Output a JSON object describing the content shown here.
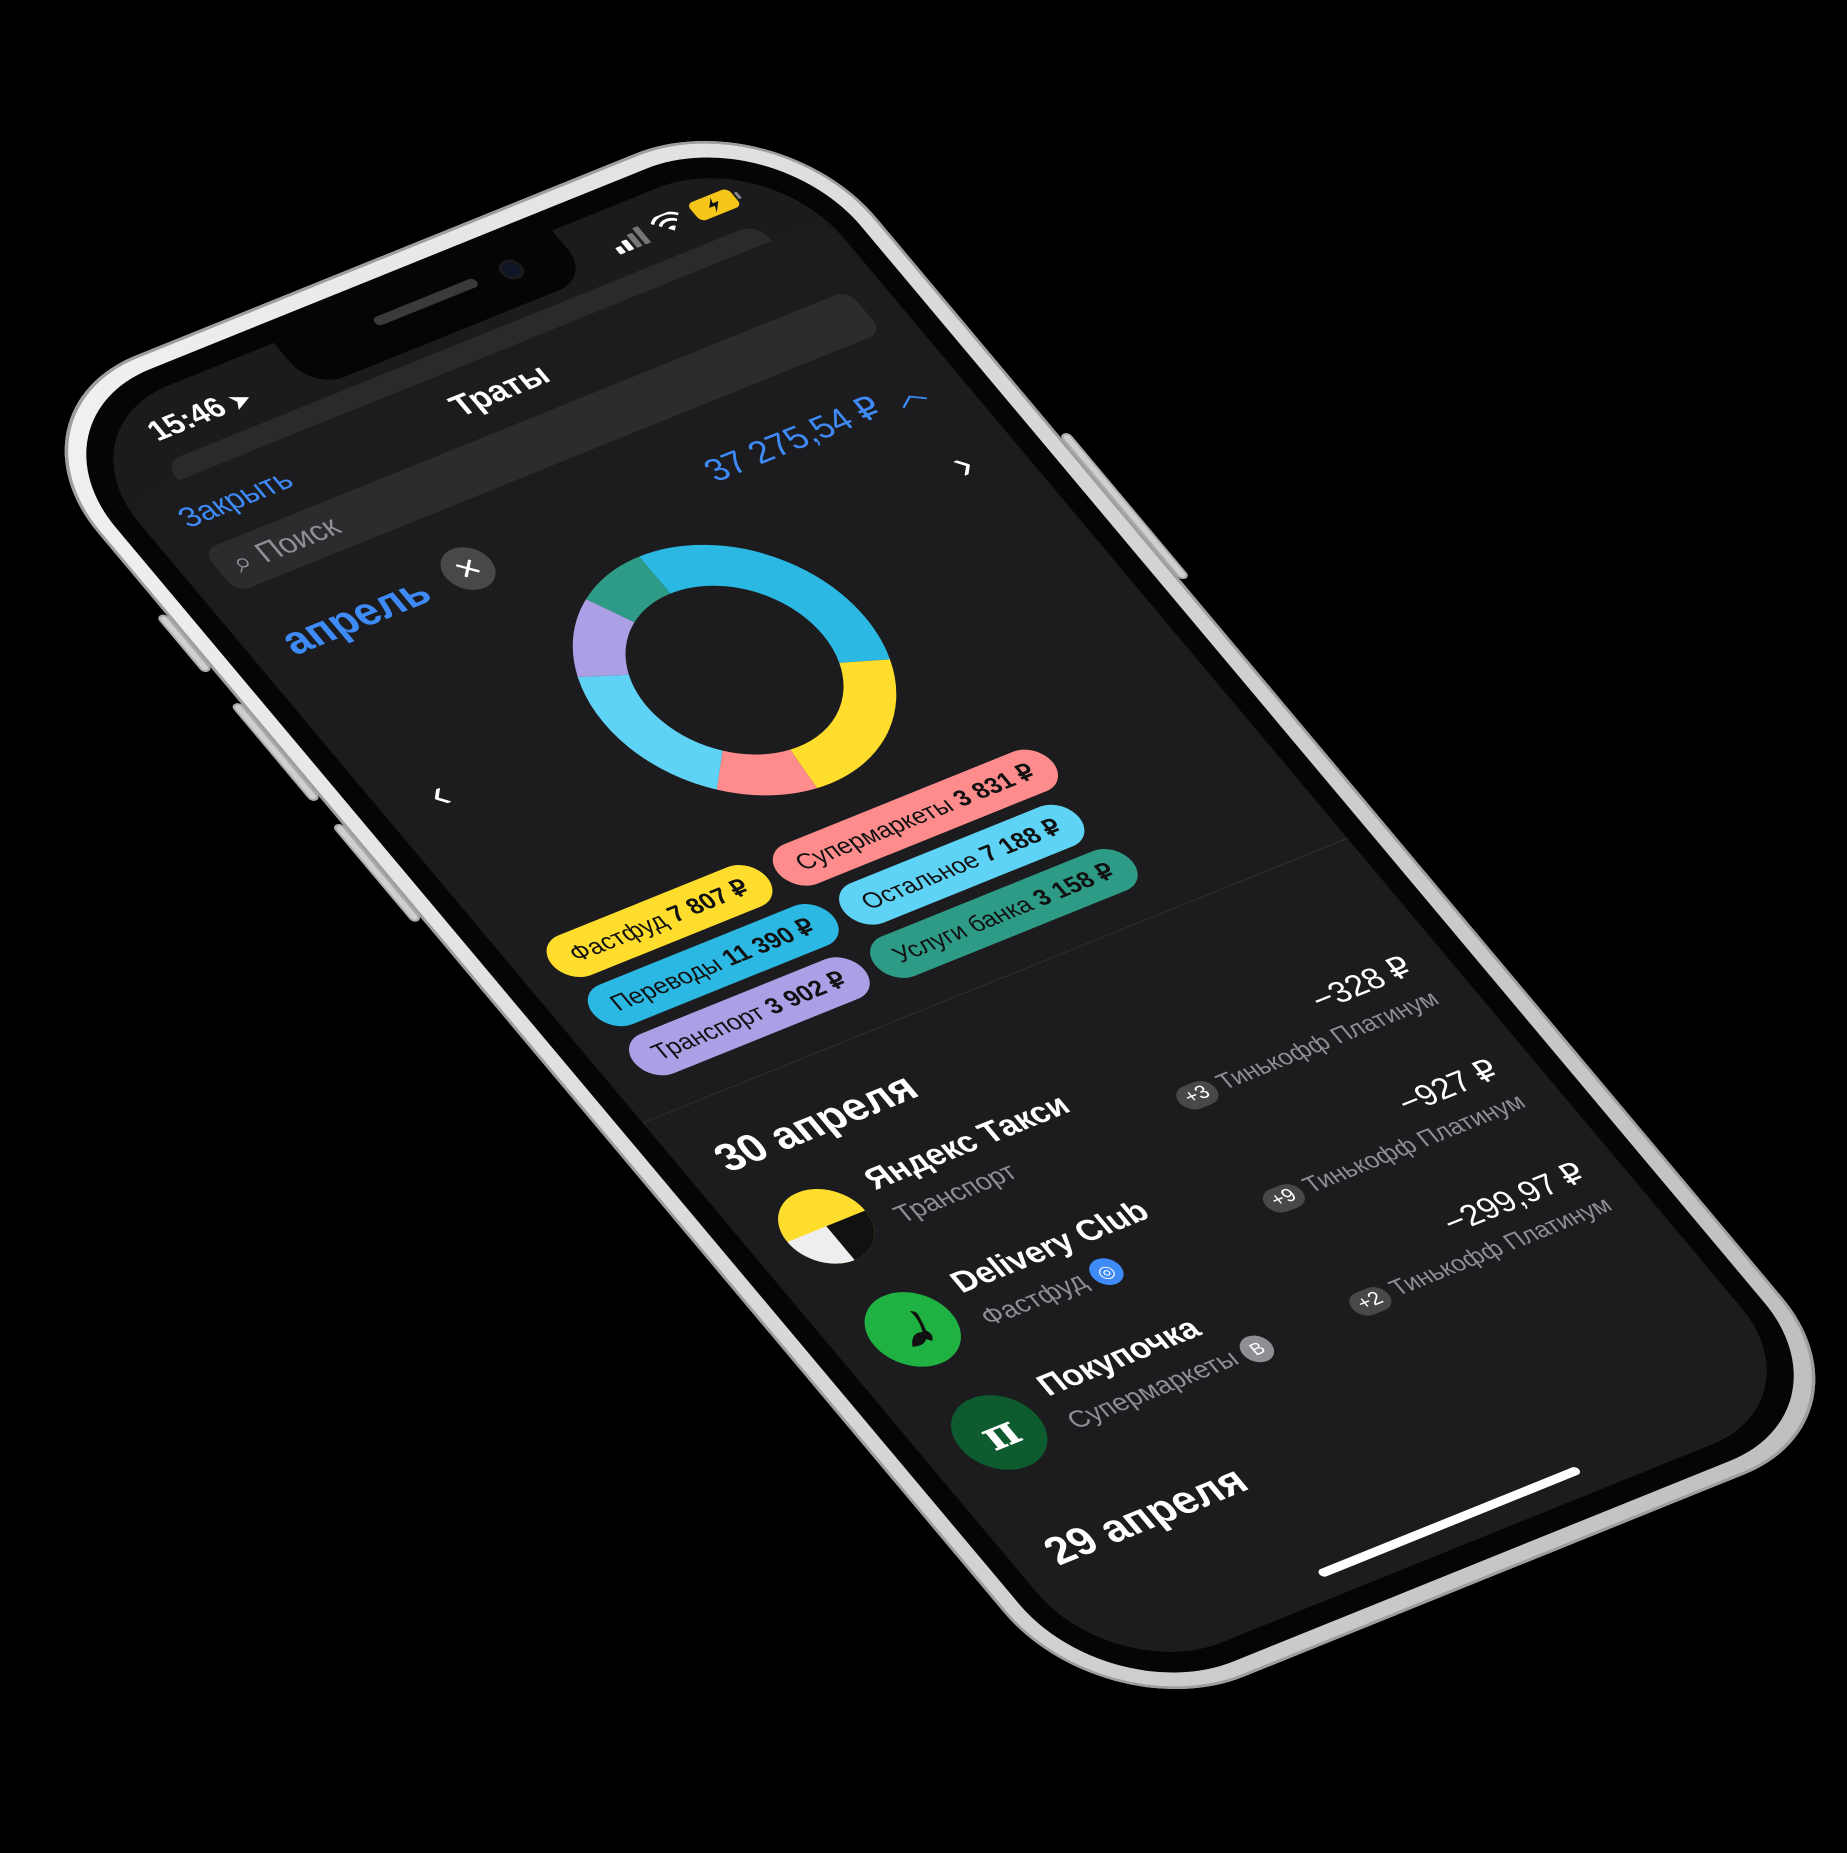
{
  "status": {
    "time": "15:46",
    "location_icon": "location-arrow-icon",
    "signal_icon": "signal-icon",
    "wifi_icon": "wifi-icon",
    "battery_icon": "battery-charging-icon"
  },
  "nav": {
    "close_label": "Закрыть",
    "title": "Траты"
  },
  "search": {
    "placeholder": "Поиск"
  },
  "period": {
    "month": "апрель",
    "total": "37 275,54 ₽"
  },
  "chart_data": {
    "type": "pie",
    "donut": true,
    "slices": [
      {
        "label": "Переводы",
        "value": 11390,
        "color": "#2bb8e3"
      },
      {
        "label": "Фастфуд",
        "value": 7807,
        "color": "#ffdd2d"
      },
      {
        "label": "Супермаркеты",
        "value": 3831,
        "color": "#ff8c8c"
      },
      {
        "label": "Остальное",
        "value": 7188,
        "color": "#5fd3f5"
      },
      {
        "label": "Транспорт",
        "value": 3902,
        "color": "#ab9fe6"
      },
      {
        "label": "Услуги банка",
        "value": 3158,
        "color": "#2e9b87"
      }
    ]
  },
  "legend": [
    {
      "category": "Фастфуд",
      "amount": "7 807 ₽",
      "color": "#ffdd2d"
    },
    {
      "category": "Супермаркеты",
      "amount": "3 831 ₽",
      "color": "#ff8c8c"
    },
    {
      "category": "Переводы",
      "amount": "11 390 ₽",
      "color": "#2bb8e3"
    },
    {
      "category": "Остальное",
      "amount": "7 188 ₽",
      "color": "#5fd3f5"
    },
    {
      "category": "Транспорт",
      "amount": "3 902 ₽",
      "color": "#ab9fe6"
    },
    {
      "category": "Услуги банка",
      "amount": "3 158 ₽",
      "color": "#2e9b87"
    }
  ],
  "days": [
    {
      "title": "30 апреля",
      "transactions": [
        {
          "name": "Яндекс Такси",
          "category": "Транспорт",
          "amount": "−328 ₽",
          "extra": "+3",
          "card": "Тинькофф Платинум",
          "logo": "yandex-taxi-logo"
        },
        {
          "name": "Delivery Club",
          "category": "Фастфуд",
          "amount": "−927 ₽",
          "extra": "+9",
          "card": "Тинькофф Платинум",
          "logo": "delivery-club-logo"
        },
        {
          "name": "Покупочка",
          "category": "Супермаркеты",
          "amount": "−299,97 ₽",
          "extra": "+2",
          "card": "Тинькофф Платинум",
          "logo": "pokupochka-logo"
        }
      ]
    },
    {
      "title": "29 апреля",
      "transactions": []
    }
  ]
}
